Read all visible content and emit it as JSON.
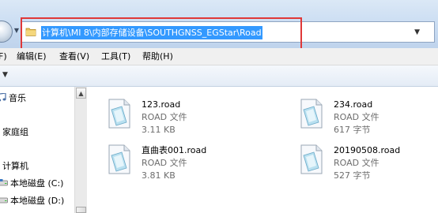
{
  "address_bar": {
    "path": "计算机\\MI 8\\内部存储设备\\SOUTHGNSS_EGStar\\Road",
    "folder_icon": "folder-icon",
    "dropdown_icon": "chevron-down-icon"
  },
  "menu": {
    "items": [
      {
        "label": "F)"
      },
      {
        "label": "编辑(E)"
      },
      {
        "label": "查看(V)"
      },
      {
        "label": "工具(T)"
      },
      {
        "label": "帮助(H)"
      }
    ]
  },
  "nav_pane": {
    "items": [
      {
        "label": "音乐",
        "icon": "music-icon"
      },
      {
        "label": "家庭组",
        "icon": "homegroup-icon"
      },
      {
        "label": "计算机",
        "icon": "computer-icon"
      },
      {
        "label": "本地磁盘 (C:)",
        "icon": "drive-icon"
      },
      {
        "label": "本地磁盘 (D:)",
        "icon": "drive-icon"
      }
    ]
  },
  "files": [
    {
      "name": "123.road",
      "type": "ROAD 文件",
      "size": "3.11 KB",
      "icon": "file-icon"
    },
    {
      "name": "234.road",
      "type": "ROAD 文件",
      "size": "617 字节",
      "icon": "file-icon"
    },
    {
      "name": "直曲表001.road",
      "type": "ROAD 文件",
      "size": "3.81 KB",
      "icon": "file-icon"
    },
    {
      "name": "20190508.road",
      "type": "ROAD 文件",
      "size": "527 字节",
      "icon": "file-icon"
    }
  ],
  "colors": {
    "selection": "#3399ff",
    "highlight_box": "#e03838",
    "address_gradient": "#c9dcf2"
  }
}
